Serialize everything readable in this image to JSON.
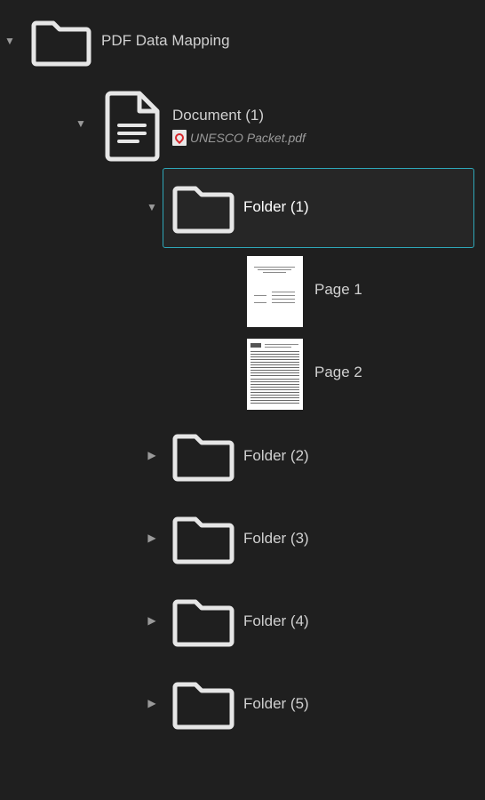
{
  "tree": {
    "root": {
      "label": "PDF Data Mapping",
      "toggle": "▼",
      "icon": "folder-icon"
    },
    "document": {
      "label": "Document (1)",
      "toggle": "▼",
      "icon": "document-icon",
      "file": {
        "name": "UNESCO Packet.pdf",
        "icon": "pdf-file-icon"
      }
    },
    "folders": [
      {
        "label": "Folder (1)",
        "toggle": "▼",
        "expanded": true,
        "selected": true
      },
      {
        "label": "Folder (2)",
        "toggle": "▶",
        "expanded": false,
        "selected": false
      },
      {
        "label": "Folder (3)",
        "toggle": "▶",
        "expanded": false,
        "selected": false
      },
      {
        "label": "Folder (4)",
        "toggle": "▶",
        "expanded": false,
        "selected": false
      },
      {
        "label": "Folder (5)",
        "toggle": "▶",
        "expanded": false,
        "selected": false
      }
    ],
    "pages": [
      {
        "label": "Page 1",
        "icon": "page-thumbnail"
      },
      {
        "label": "Page 2",
        "icon": "page-thumbnail"
      }
    ]
  },
  "colors": {
    "background": "#1f1f1f",
    "selection_border": "#2ea7b8",
    "icon_stroke": "#e6e6e6",
    "text": "#d0d0d0",
    "muted_text": "#9a9a9a"
  }
}
